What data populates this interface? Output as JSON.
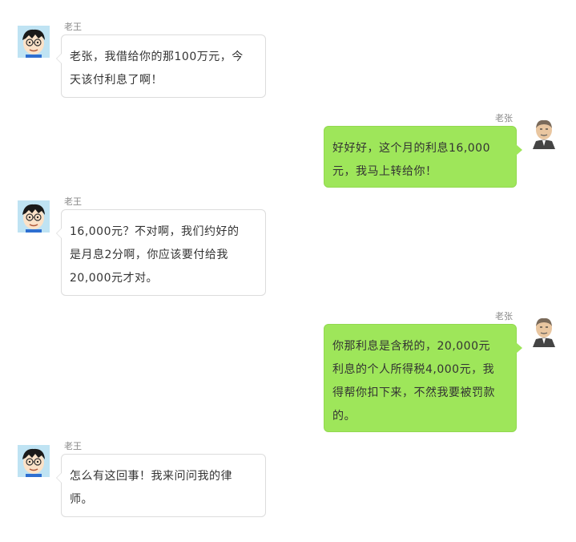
{
  "people": {
    "left_name": "老王",
    "right_name": "老张",
    "left_avatar": "cartoon-boy-avatar-icon",
    "right_avatar": "old-man-avatar-icon"
  },
  "messages": [
    {
      "side": "left",
      "name": "老王",
      "lines": [
        "老张，我借给你的那100万元，今",
        "天该付利息了啊！"
      ]
    },
    {
      "side": "right",
      "name": "老张",
      "lines": [
        "好好好，这个月的利息16,000",
        "元，我马上转给你！"
      ]
    },
    {
      "side": "left",
      "name": "老王",
      "lines": [
        "16,000元？不对啊，我们约好的",
        "是月息2分啊，你应该要付给我",
        "20,000元才对。"
      ]
    },
    {
      "side": "right",
      "name": "老张",
      "lines": [
        "你那利息是含税的，20,000元",
        "利息的个人所得税4,000元，我",
        "得帮你扣下来，不然我要被罚款",
        "的。"
      ]
    },
    {
      "side": "left",
      "name": "老王",
      "lines": [
        "怎么有这回事！我来问问我的律",
        "师。"
      ]
    }
  ],
  "colors": {
    "left_bubble": "#ffffff",
    "left_border": "#dcdcdc",
    "right_bubble": "#9ee65a",
    "name_text": "#888888",
    "message_text": "#333333"
  }
}
